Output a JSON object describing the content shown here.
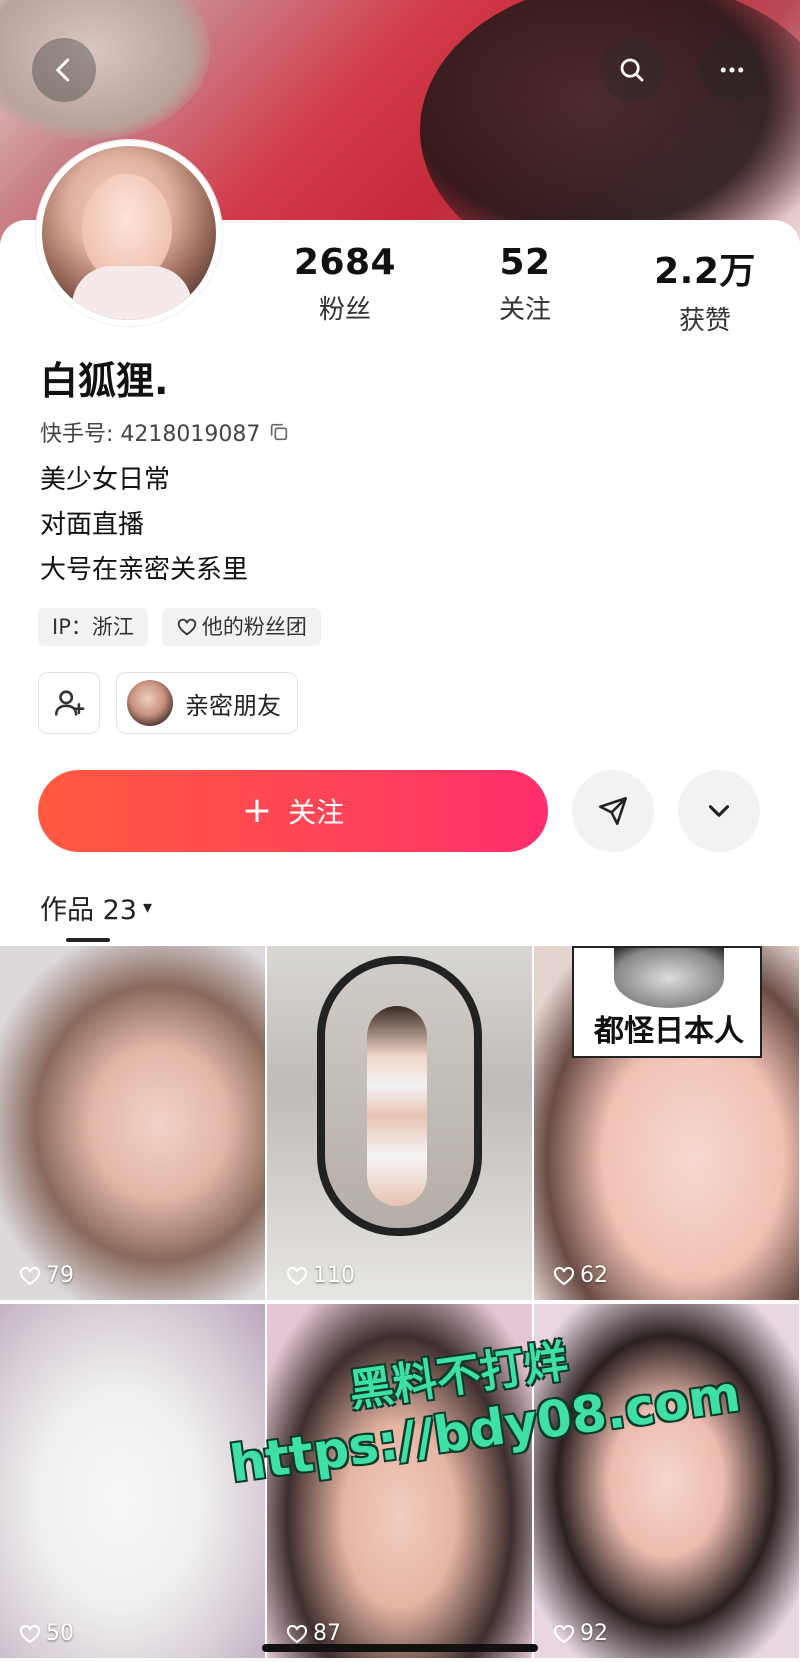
{
  "header": {
    "back_icon": "chevron-left-icon",
    "search_icon": "search-icon",
    "more_icon": "more-dots-icon"
  },
  "profile": {
    "stats": [
      {
        "num": "2684",
        "label": "粉丝"
      },
      {
        "num": "52",
        "label": "关注"
      },
      {
        "num": "2.2万",
        "label": "获赞"
      }
    ],
    "name": "白狐狸.",
    "uid": "快手号: 4218019087",
    "bio": [
      "美少女日常",
      "对面直播",
      "大号在亲密关系里"
    ],
    "tags": {
      "ip": "IP：浙江",
      "fanclub": "他的粉丝团"
    },
    "intimate_friends": "亲密朋友"
  },
  "actions": {
    "follow_plus": "+",
    "follow_label": "关注"
  },
  "works": {
    "label": "作品 23",
    "caret": "▾",
    "tiles": [
      {
        "likes": "79"
      },
      {
        "likes": "110"
      },
      {
        "likes": "62",
        "overlay_text": "都怪日本人"
      },
      {
        "likes": "50"
      },
      {
        "likes": "87"
      },
      {
        "likes": "92"
      }
    ]
  },
  "watermark": {
    "line1": "黑料不打烊",
    "line2": "https://bdy08.com"
  },
  "colors": {
    "follow_gradient_start": "#ff5a40",
    "follow_gradient_end": "#ff2d6d",
    "watermark": "#3ee0a6"
  }
}
